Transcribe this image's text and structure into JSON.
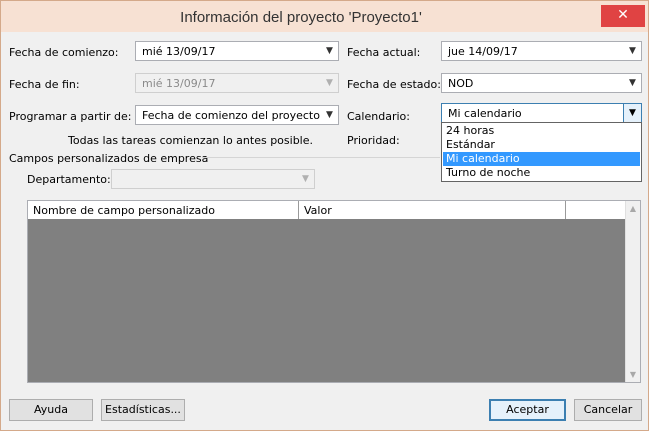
{
  "dialog": {
    "title": "Información del proyecto 'Proyecto1'",
    "close_glyph": "✕"
  },
  "fields": {
    "start_date": {
      "label": "Fecha de comienzo:",
      "value": "mié 13/09/17"
    },
    "end_date": {
      "label": "Fecha de fin:",
      "value": "mié 13/09/17"
    },
    "schedule_from": {
      "label": "Programar a partir de:",
      "value": "Fecha de comienzo del proyecto"
    },
    "schedule_note": "Todas las tareas comienzan lo antes posible.",
    "current_date": {
      "label": "Fecha actual:",
      "value": "jue 14/09/17"
    },
    "status_date": {
      "label": "Fecha de estado:",
      "value": "NOD"
    },
    "calendar": {
      "label": "Calendario:",
      "value": "Mi calendario"
    },
    "priority": {
      "label": "Prioridad:"
    }
  },
  "calendar_options": [
    "24 horas",
    "Estándar",
    "Mi calendario",
    "Turno de noche"
  ],
  "enterprise": {
    "group_label": "Campos personalizados de empresa",
    "department_label": "Departamento:",
    "department_value": ""
  },
  "grid": {
    "columns": [
      "Nombre de campo personalizado",
      "Valor"
    ]
  },
  "buttons": {
    "help": "Ayuda",
    "statistics": "Estadísticas...",
    "accept": "Aceptar",
    "cancel": "Cancelar"
  },
  "icons": {
    "dropdown_arrow": "chevron-down-icon",
    "close": "close-icon",
    "scroll_up": "scroll-up-arrow-icon",
    "scroll_down": "scroll-down-arrow-icon"
  },
  "colors": {
    "titlebar": "#f7e1d3",
    "close_button": "#e04343",
    "selection": "#3399ff",
    "grid_background": "#808080",
    "focus_border": "#3c7fb1"
  }
}
